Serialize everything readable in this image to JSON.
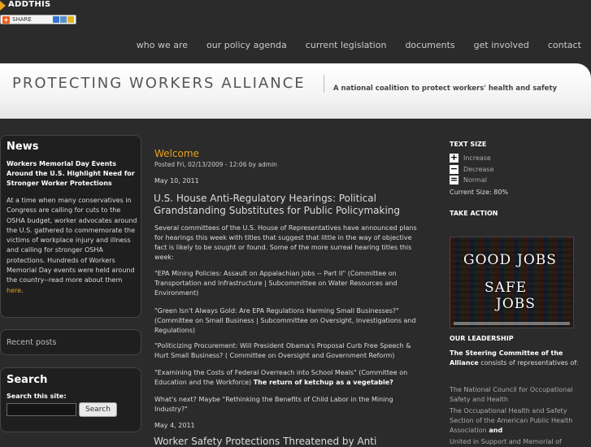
{
  "addthis": {
    "title": "ADDTHIS",
    "share_label": "SHARE"
  },
  "nav": {
    "items": [
      {
        "label": "who we are"
      },
      {
        "label": "our policy agenda"
      },
      {
        "label": "current legislation"
      },
      {
        "label": "documents"
      },
      {
        "label": "get involved"
      },
      {
        "label": "contact"
      }
    ]
  },
  "header": {
    "site_title": "PROTECTING WORKERS ALLIANCE",
    "tagline": "A national coalition to protect workers' health and safety"
  },
  "news": {
    "title": "News",
    "headline": "Workers Memorial Day Events Around the U.S. Highlight Need for Stronger Worker Protections",
    "body": "At a time when many conservatives in Congress are calling for cuts to the OSHA budget, worker advocates around the U.S. gathered to commemorate the victims of workplace injury and illness and calling for stronger OSHA protections. Hundreds of Workers Memorial Day events were held around the country--read more about them ",
    "link": "here",
    "end": "."
  },
  "recent": {
    "label": "Recent posts"
  },
  "search": {
    "title": "Search",
    "label": "Search this site:",
    "value": "",
    "button": "Search"
  },
  "main": {
    "title": "Welcome",
    "posted": "Posted Fri, 02/13/2009 - 12:06 by admin",
    "date1": "May 10, 2011",
    "article_title": "U.S. House Anti-Regulatory Hearings: Political Grandstanding Substitutes for Public Policymaking",
    "p1": "Several committees of the U.S. House of Representatives have announced plans for hearings this week with titles that suggest that little in the way of objective fact is likely to be sought or found. Some of the more surreal hearing titles this week:",
    "p2": "\"EPA Mining Policies: Assault on Appalachian Jobs -- Part II\" (Committee on Transportation and Infrastructure | Subcommittee on Water Resources and Environment)",
    "p3": "\"Green Isn't Always Gold: Are EPA Regulations Harming Small Businesses?\" (Committee on Small Business | Subcommittee on Oversight, Investigations and Regulations)",
    "p4": "\"Politicizing Procurement: Will President Obama's Proposal Curb Free Speech & Hurt Small Business? ( Committee on Oversight and Government Reform)",
    "p5_text": "\"Examining the Costs of Federal Overreach into School Meals\" (Committee on Education and the Workforce) ",
    "p5_bold": "The return of ketchup as a vegetable?",
    "p6": "What's next? Maybe \"Rethinking the Benefits of Child Labor in the Mining Industry?\"",
    "date2": "May 4, 2011",
    "article2_title": "Worker Safety Protections Threatened by Anti"
  },
  "sidebar_right": {
    "text_size_title": "TEXT SIZE",
    "increase": "Increase",
    "decrease": "Decrease",
    "normal": "Normal",
    "current_size": "Current Size:  80%",
    "take_action": "TAKE ACTION",
    "poster": {
      "line1a": "GOOD",
      "line1b": "JOBS",
      "line2": "SAFE",
      "line3": "JOBS"
    },
    "leadership": "OUR LEADERSHIP",
    "steering_bold": "The Steering Committee of the Alliance",
    "steering_text": " consists of representatives of:",
    "orgs": [
      "The National Council for Occupational Safety and Health",
      "The Occupational Health and Safety Section of the American Public Health Association",
      "United in Support and Memorial of"
    ],
    "org2_end": " and"
  }
}
